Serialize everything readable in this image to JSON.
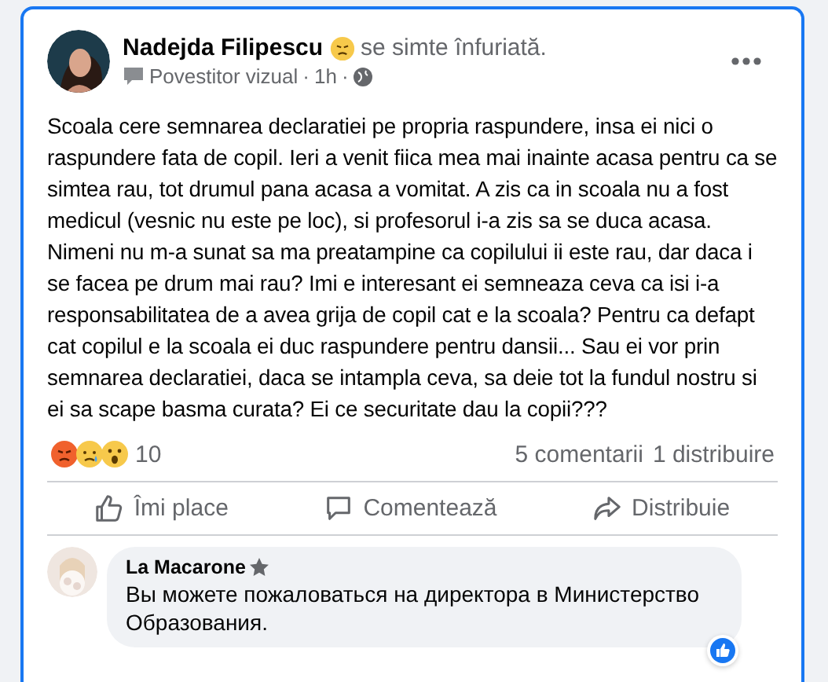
{
  "post": {
    "author": "Nadejda Filipescu",
    "feeling": "se simte înfuriată.",
    "badge": "Povestitor vizual",
    "separator": "·",
    "time": "1h",
    "body": "Scoala cere semnarea declaratiei pe propria raspundere, insa ei nici o raspundere fata de copil. Ieri a venit fiica mea mai inainte acasa pentru ca se simtea rau, tot drumul pana acasa a vomitat. A zis ca in scoala nu a fost medicul (vesnic nu este pe loc), si profesorul i-a zis sa se duca acasa. Nimeni nu m-a sunat sa ma preatampine ca copilului ii este rau, dar daca i se facea pe drum mai rau? Imi e interesant ei semneaza ceva ca isi i-a responsabilitatea de a avea grija de copil cat e la scoala? Pentru ca defapt cat copilul e la scoala ei duc raspundere pentru dansii... Sau ei vor prin semnarea declaratiei, daca se intampla ceva, sa deie tot la fundul nostru si ei sa scape basma curata? Ei ce securitate dau la copii???",
    "reactions": [
      {
        "kind": "angry"
      },
      {
        "kind": "sad"
      },
      {
        "kind": "wow"
      }
    ],
    "reaction_count": "10",
    "comments": "5 comentarii",
    "shares": "1 distribuire"
  },
  "actions": [
    {
      "kind": "like",
      "label": "Îmi place"
    },
    {
      "kind": "comment",
      "label": "Comentează"
    },
    {
      "kind": "share",
      "label": "Distribuie"
    }
  ],
  "comment": {
    "author": "La Macarone",
    "text": "Вы можете пожаловаться на директора в Министерство Образования."
  }
}
